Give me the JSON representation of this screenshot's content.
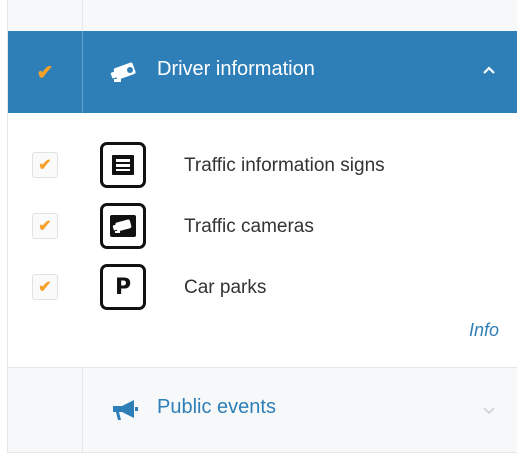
{
  "sections": {
    "active": {
      "title": "Driver information",
      "checked": true,
      "expanded": true,
      "icon": "camera-icon",
      "items": [
        {
          "label": "Traffic information signs",
          "checked": true,
          "icon": "traffic-sign-icon"
        },
        {
          "label": "Traffic cameras",
          "checked": true,
          "icon": "traffic-camera-icon"
        },
        {
          "label": "Car parks",
          "checked": true,
          "icon": "car-park-icon",
          "sign_letter": "P"
        }
      ],
      "info_link": "Info"
    },
    "collapsed": {
      "title": "Public events",
      "expanded": false,
      "icon": "megaphone-icon"
    }
  },
  "colors": {
    "header_blue": "#2e7fb8",
    "check_orange": "#f7a02a",
    "text_dark": "#333333",
    "row_grey": "#f7f8f9"
  },
  "glyphs": {
    "check": "✔"
  }
}
